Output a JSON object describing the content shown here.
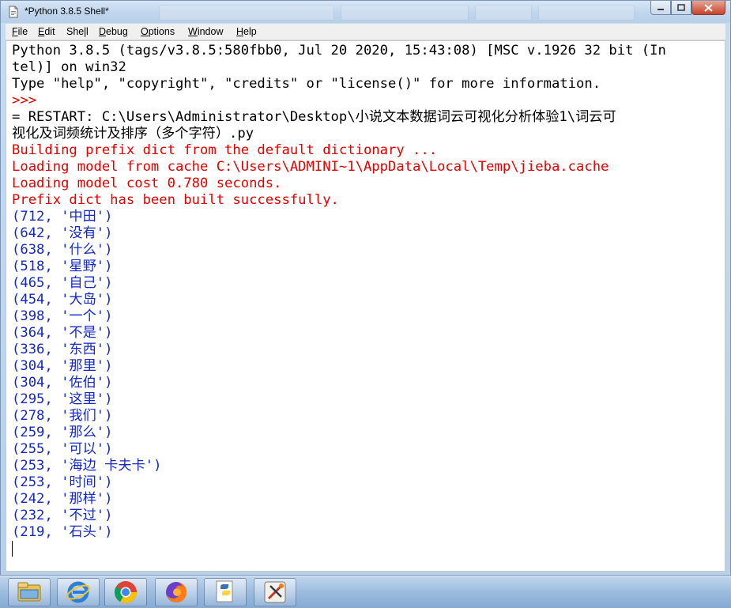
{
  "window": {
    "title": "*Python 3.8.5 Shell*"
  },
  "menu": {
    "items": [
      {
        "accel": "F",
        "rest": "ile"
      },
      {
        "accel": "E",
        "rest": "dit"
      },
      {
        "pre": "She",
        "accel": "l",
        "rest": "l"
      },
      {
        "accel": "D",
        "rest": "ebug"
      },
      {
        "accel": "O",
        "rest": "ptions"
      },
      {
        "accel": "W",
        "rest": "indow"
      },
      {
        "accel": "H",
        "rest": "elp"
      }
    ]
  },
  "shell": {
    "lines": [
      {
        "text": "Python 3.8.5 (tags/v3.8.5:580fbb0, Jul 20 2020, 15:43:08) [MSC v.1926 32 bit (In",
        "color": "#000000"
      },
      {
        "text": "tel)] on win32",
        "color": "#000000"
      },
      {
        "text": "Type \"help\", \"copyright\", \"credits\" or \"license()\" for more information.",
        "color": "#000000"
      },
      {
        "text": ">>> ",
        "color": "#e40000"
      },
      {
        "text": "= RESTART: C:\\Users\\Administrator\\Desktop\\小说文本数据词云可视化分析体验1\\词云可",
        "color": "#000000"
      },
      {
        "text": "视化及词频统计及排序（多个字符）.py",
        "color": "#000000"
      },
      {
        "text": "Building prefix dict from the default dictionary ...",
        "color": "#e40000"
      },
      {
        "text": "Loading model from cache C:\\Users\\ADMINI~1\\AppData\\Local\\Temp\\jieba.cache",
        "color": "#e40000"
      },
      {
        "text": "Loading model cost 0.780 seconds.",
        "color": "#e40000"
      },
      {
        "text": "Prefix dict has been built successfully.",
        "color": "#e40000"
      },
      {
        "text": "(712, '中田')",
        "color": "#1428c8"
      },
      {
        "text": "(642, '没有')",
        "color": "#1428c8"
      },
      {
        "text": "(638, '什么')",
        "color": "#1428c8"
      },
      {
        "text": "(518, '星野')",
        "color": "#1428c8"
      },
      {
        "text": "(465, '自己')",
        "color": "#1428c8"
      },
      {
        "text": "(454, '大岛')",
        "color": "#1428c8"
      },
      {
        "text": "(398, '一个')",
        "color": "#1428c8"
      },
      {
        "text": "(364, '不是')",
        "color": "#1428c8"
      },
      {
        "text": "(336, '东西')",
        "color": "#1428c8"
      },
      {
        "text": "(304, '那里')",
        "color": "#1428c8"
      },
      {
        "text": "(304, '佐伯')",
        "color": "#1428c8"
      },
      {
        "text": "(295, '这里')",
        "color": "#1428c8"
      },
      {
        "text": "(278, '我们')",
        "color": "#1428c8"
      },
      {
        "text": "(259, '那么')",
        "color": "#1428c8"
      },
      {
        "text": "(255, '可以')",
        "color": "#1428c8"
      },
      {
        "text": "(253, '海边 卡夫卡')",
        "color": "#1428c8"
      },
      {
        "text": "(253, '时间')",
        "color": "#1428c8"
      },
      {
        "text": "(242, '那样')",
        "color": "#1428c8"
      },
      {
        "text": "(232, '不过')",
        "color": "#1428c8"
      },
      {
        "text": "(219, '石头')",
        "color": "#1428c8"
      }
    ]
  },
  "taskbar": {
    "apps": [
      {
        "icon": "file-explorer-icon"
      },
      {
        "icon": "internet-explorer-icon"
      },
      {
        "icon": "chrome-icon"
      },
      {
        "icon": "firefox-icon"
      },
      {
        "icon": "python-idle-icon"
      },
      {
        "icon": "tool-app-icon"
      }
    ]
  }
}
